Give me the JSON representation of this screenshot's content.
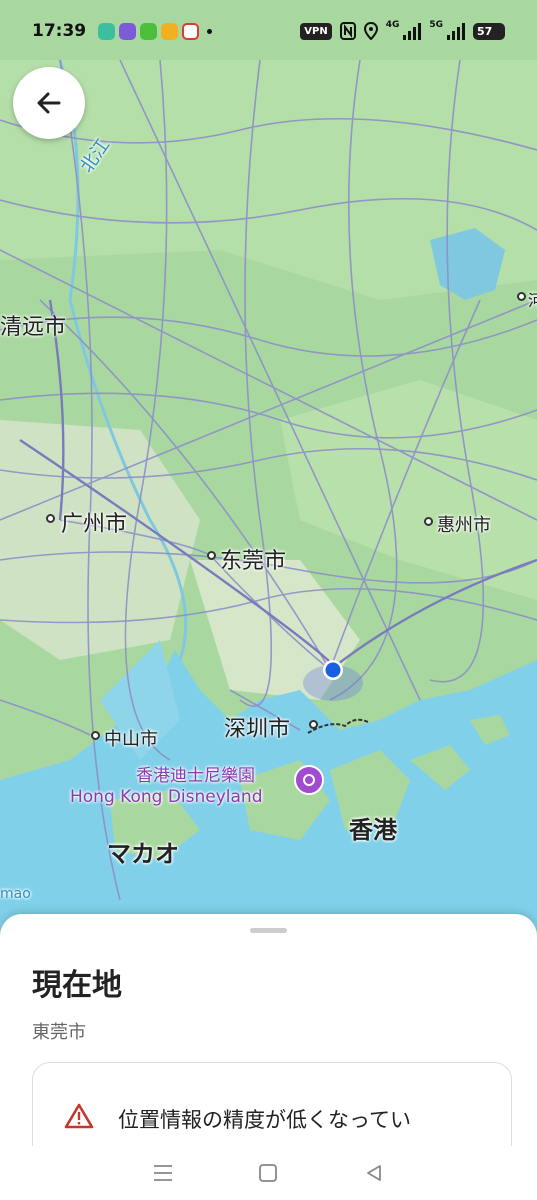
{
  "status_bar": {
    "time": "17:39",
    "vpn_label": "VPN",
    "net_4g": "4G",
    "net_5g": "5G",
    "battery": "57"
  },
  "map": {
    "labels": {
      "qingyuan": "清远市",
      "guangzhou": "广州市",
      "dongguan": "东莞市",
      "huizhou": "惠州市",
      "shenzhen": "深圳市",
      "zhongshan": "中山市",
      "hongkong": "香港",
      "macau": "マカオ",
      "beijiang": "北江",
      "disney_cn": "香港迪士尼樂園",
      "disney_en": "Hong Kong Disneyland",
      "edge_left": "mao",
      "edge_right": "河"
    },
    "colors": {
      "land": "#a8d8a0",
      "sea": "#7fd0e8",
      "road": "#8e8fc8",
      "location": "#1a5fe0"
    }
  },
  "sheet": {
    "title": "現在地",
    "subtitle": "東莞市",
    "warning": "位置情報の精度が低くなってい"
  },
  "icons": {
    "back": "arrow-left-icon",
    "warning": "warning-triangle-icon",
    "nav_menu": "menu-icon",
    "nav_home": "home-square-icon",
    "nav_back": "back-triangle-icon"
  }
}
